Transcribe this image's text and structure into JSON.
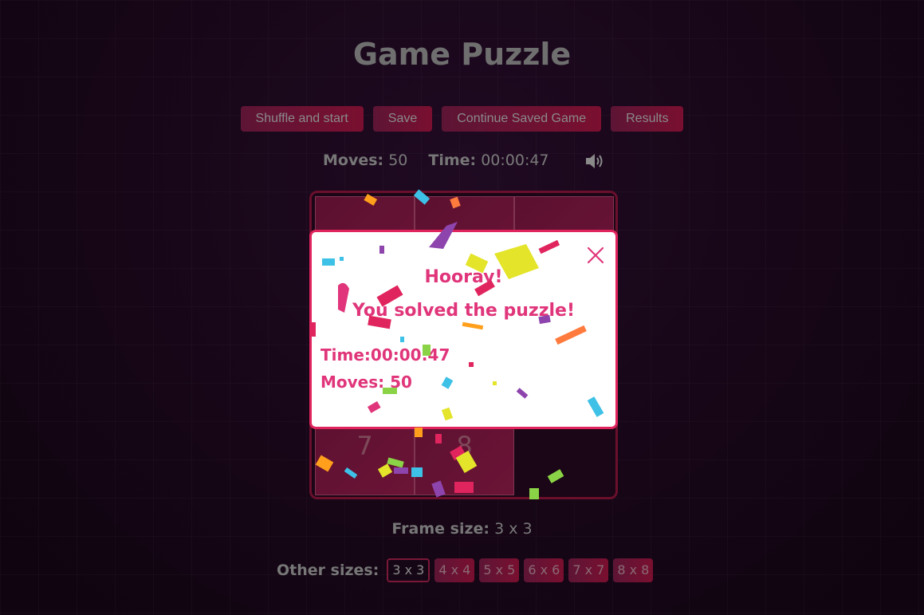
{
  "app": {
    "title": "Game Puzzle"
  },
  "toolbar": {
    "shuffle_label": "Shuffle and start",
    "save_label": "Save",
    "continue_label": "Continue Saved Game",
    "results_label": "Results"
  },
  "stats": {
    "moves_label": "Moves:",
    "moves_value": "50",
    "time_label": "Time:",
    "time_value": "00:00:47",
    "sound_icon": "speaker-on-icon"
  },
  "board": {
    "tiles": [
      "",
      "",
      "",
      "",
      "",
      "",
      "7",
      "8",
      ""
    ]
  },
  "frame": {
    "label": "Frame size:",
    "value": "3 x 3"
  },
  "sizes": {
    "label": "Other sizes:",
    "options": [
      "3 x 3",
      "4 x 4",
      "5 x 5",
      "6 x 6",
      "7 x 7",
      "8 x 8"
    ],
    "active": "3 x 3"
  },
  "modal": {
    "line1": "Hooray!",
    "line2": "You solved the puzzle!",
    "time": "Time:00:00:47",
    "moves": "Moves: 50",
    "close_icon": "close-icon"
  },
  "colors": {
    "accent": "#e0245e",
    "button": "#6b1436",
    "background": "#160616"
  }
}
